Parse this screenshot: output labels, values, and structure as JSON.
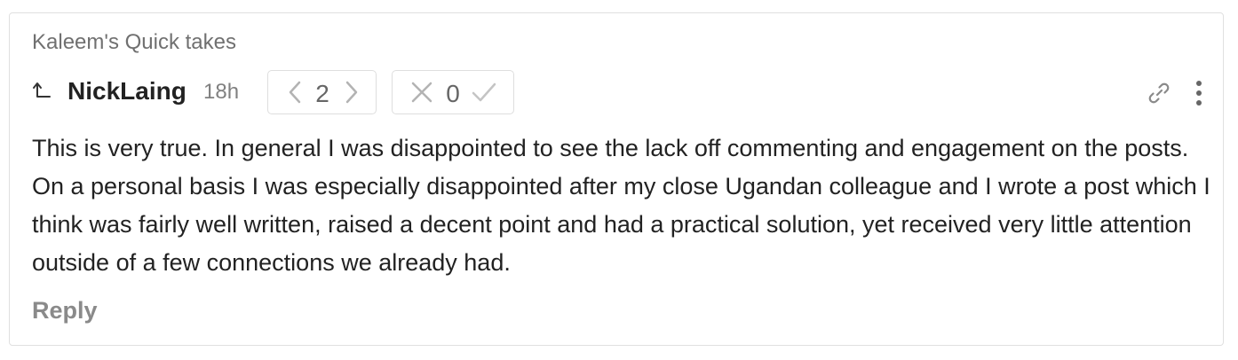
{
  "breadcrumb": "Kaleem's Quick takes",
  "comment": {
    "author": "NickLaing",
    "age": "18h",
    "karma": "2",
    "agreement": "0",
    "body": "This is very true. In general I was disappointed to see the lack off commenting and engagement on the posts. On a personal basis I was especially disappointed after my close Ugandan colleague and I wrote a post which I think was fairly well written, raised a decent point and had a practical solution, yet received very little attention outside of a few connections we already had.",
    "reply_label": "Reply"
  },
  "icons": {
    "parent": "parent-comment-arrow-icon",
    "karma_down": "chevron-left-icon",
    "karma_up": "chevron-right-icon",
    "disagree": "cross-icon",
    "agree": "check-icon",
    "link": "link-icon",
    "more": "vertical-dots-icon"
  },
  "colors": {
    "text": "#222222",
    "muted": "#707070",
    "border": "#e0e0e0",
    "icon": "#b0b0b0"
  }
}
